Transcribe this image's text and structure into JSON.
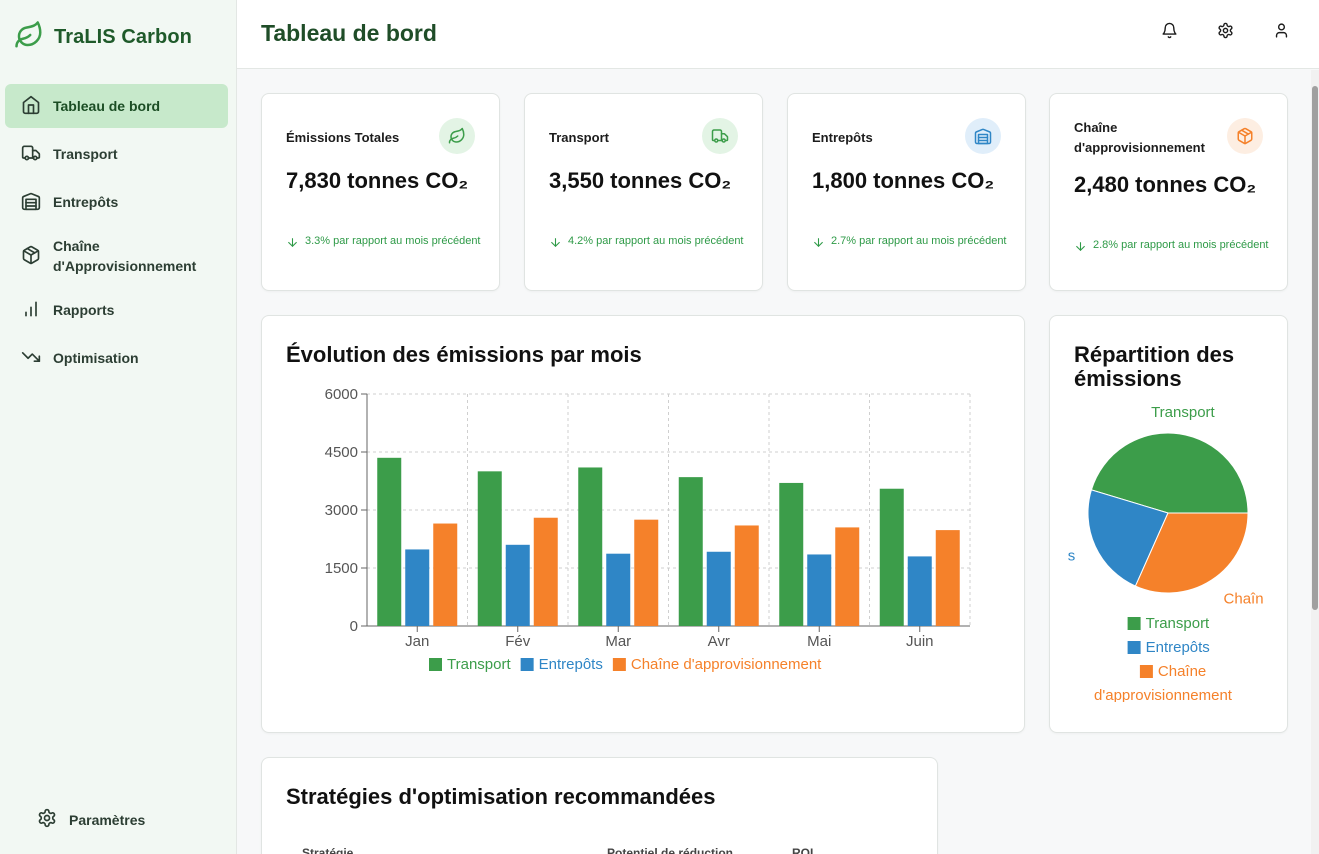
{
  "app": {
    "name": "TraLIS Carbon"
  },
  "sidebar": {
    "items": [
      {
        "label": "Tableau de bord",
        "icon": "home-icon"
      },
      {
        "label": "Transport",
        "icon": "truck-icon"
      },
      {
        "label": "Entrepôts",
        "icon": "warehouse-icon"
      },
      {
        "label": "Chaîne d'Approvisionnement",
        "icon": "package-icon"
      },
      {
        "label": "Rapports",
        "icon": "bar-chart-icon"
      },
      {
        "label": "Optimisation",
        "icon": "trending-down-icon"
      }
    ],
    "settings_label": "Paramètres"
  },
  "header": {
    "title": "Tableau de bord"
  },
  "stats": [
    {
      "title": "Émissions Totales",
      "value": "7,830 tonnes CO₂",
      "change": "3.3% par rapport au mois précédent",
      "icon": "leaf-icon"
    },
    {
      "title": "Transport",
      "value": "3,550 tonnes CO₂",
      "change": "4.2% par rapport au mois précédent",
      "icon": "truck-icon"
    },
    {
      "title": "Entrepôts",
      "value": "1,800 tonnes CO₂",
      "change": "2.7% par rapport au mois précédent",
      "icon": "warehouse-icon"
    },
    {
      "title": "Chaîne d'approvisionnement",
      "value": "2,480 tonnes CO₂",
      "change": "2.8% par rapport au mois précédent",
      "icon": "package-icon"
    }
  ],
  "colors": {
    "transport": "#3c9d4a",
    "entrepots": "#2f86c6",
    "chaine": "#f5812a",
    "brand": "#1f5a2a"
  },
  "bar_section": {
    "title": "Évolution des émissions par mois"
  },
  "pie_section": {
    "title": "Répartition des émissions"
  },
  "strategy_section": {
    "title": "Stratégies d'optimisation recommandées",
    "columns": [
      "Stratégie",
      "Potentiel de réduction",
      "ROI"
    ]
  },
  "chart_data": [
    {
      "type": "bar",
      "title": "Évolution des émissions par mois",
      "categories": [
        "Jan",
        "Fév",
        "Mar",
        "Avr",
        "Mai",
        "Juin"
      ],
      "series": [
        {
          "name": "Transport",
          "values": [
            4350,
            4000,
            4100,
            3850,
            3700,
            3550
          ]
        },
        {
          "name": "Entrepôts",
          "values": [
            1980,
            2100,
            1870,
            1920,
            1850,
            1800
          ]
        },
        {
          "name": "Chaîne d'approvisionnement",
          "values": [
            2650,
            2800,
            2750,
            2600,
            2550,
            2480
          ]
        }
      ],
      "ylim": [
        0,
        6000
      ],
      "yticks": [
        "0",
        "1500",
        "3000",
        "4500",
        "6000"
      ],
      "grid": true,
      "legend": "bottom"
    },
    {
      "type": "pie",
      "title": "Répartition des émissions",
      "labels": [
        "Transport",
        "Entrepôts",
        "Chaîne d'approvisionnement"
      ],
      "values": [
        3550,
        1800,
        2480
      ],
      "slice_labels": [
        "Transport",
        "s",
        "Chaîn"
      ],
      "legend": "bottom"
    }
  ]
}
